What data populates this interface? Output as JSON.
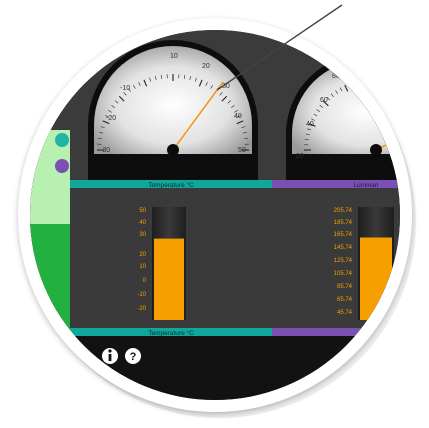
{
  "gauges": [
    {
      "id": "temperature",
      "ticks": [
        "-30",
        "-20",
        "-10",
        "10",
        "20",
        "30",
        "40",
        "50"
      ],
      "label": "Temperature °C",
      "bar_color": "#0fa89a",
      "needle_value": 28
    },
    {
      "id": "luminance",
      "ticks": [
        "60",
        "40",
        "20",
        "80"
      ],
      "label": "Luminan",
      "bar_color": "#7b4fb3"
    }
  ],
  "bar_meters": [
    {
      "id": "temperature-meter",
      "scale": [
        "50",
        "40",
        "30",
        "20",
        "10",
        "0",
        "-10",
        "-20"
      ],
      "label": "Temperature °C",
      "fill_level": 0.74,
      "fill_color": "#f5a000"
    },
    {
      "id": "luminance-meter",
      "scale": [
        "205.74",
        "185.74",
        "165.74",
        "145.74",
        "125.74",
        "105.74",
        "85.74",
        "65.74",
        "45.74"
      ],
      "fill_level": 0.75,
      "fill_color": "#f5a000"
    }
  ],
  "toolbar": {
    "info_icon": "info-icon",
    "help_icon": "help-icon"
  },
  "colors": {
    "panel_bg": "#3b3b3b",
    "teal": "#0fa89a",
    "purple": "#7b4fb3",
    "green": "#22b040",
    "light_green": "#b7f0b0",
    "orange": "#f5a000"
  }
}
